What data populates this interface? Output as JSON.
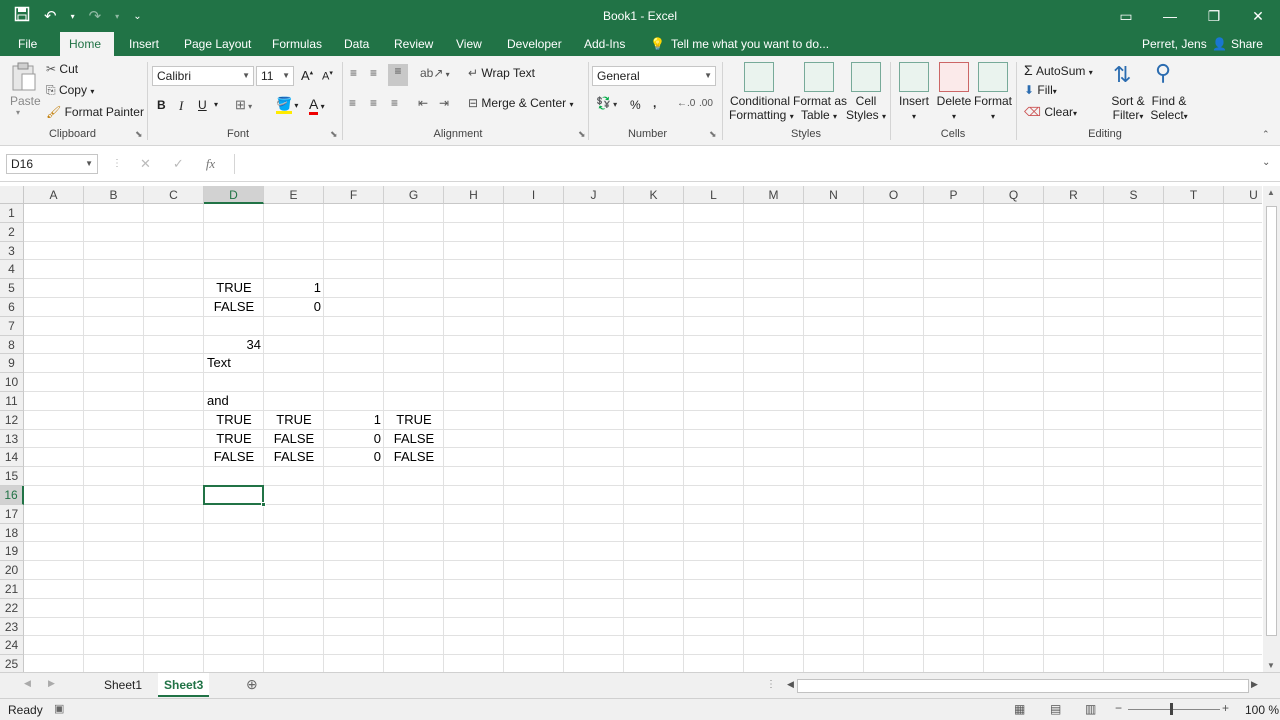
{
  "window": {
    "title": "Book1 - Excel",
    "save_icon": "save-icon",
    "undo_icon": "undo-icon",
    "redo_icon": "redo-icon"
  },
  "menu": {
    "tabs": [
      "File",
      "Home",
      "Insert",
      "Page Layout",
      "Formulas",
      "Data",
      "Review",
      "View",
      "Developer",
      "Add-Ins"
    ],
    "active_tab": "Home",
    "tell_me": "Tell me what you want to do...",
    "user": "Perret, Jens",
    "share": "Share"
  },
  "ribbon": {
    "clipboard": {
      "paste": "Paste",
      "cut": "Cut",
      "copy": "Copy",
      "format_painter": "Format Painter",
      "label": "Clipboard"
    },
    "font": {
      "name": "Calibri",
      "size": "11",
      "bold": "B",
      "italic": "I",
      "underline": "U",
      "label": "Font"
    },
    "alignment": {
      "wrap": "Wrap Text",
      "merge": "Merge & Center",
      "label": "Alignment"
    },
    "number": {
      "format": "General",
      "percent": "%",
      "comma": ",",
      "label": "Number"
    },
    "styles": {
      "cond1": "Conditional",
      "cond2": "Formatting",
      "fmt1": "Format as",
      "fmt2": "Table",
      "cell1": "Cell",
      "cell2": "Styles",
      "label": "Styles"
    },
    "cells": {
      "insert": "Insert",
      "delete": "Delete",
      "format": "Format",
      "label": "Cells"
    },
    "editing": {
      "autosum": "AutoSum",
      "fill": "Fill",
      "clear": "Clear",
      "sort1": "Sort &",
      "sort2": "Filter",
      "find1": "Find &",
      "find2": "Select",
      "label": "Editing"
    }
  },
  "formula_bar": {
    "name_box": "D16",
    "fx": "fx",
    "value": ""
  },
  "columns": [
    "A",
    "B",
    "C",
    "D",
    "E",
    "F",
    "G",
    "H",
    "I",
    "J",
    "K",
    "L",
    "M",
    "N",
    "O",
    "P",
    "Q",
    "R",
    "S",
    "T",
    "U"
  ],
  "rows": [
    "1",
    "2",
    "3",
    "4",
    "5",
    "6",
    "7",
    "8",
    "9",
    "10",
    "11",
    "12",
    "13",
    "14",
    "15",
    "16",
    "17",
    "18",
    "19",
    "20",
    "21",
    "22",
    "23",
    "24",
    "25"
  ],
  "cells": {
    "D5": "TRUE",
    "E5": "1",
    "D6": "FALSE",
    "E6": "0",
    "D8": "34",
    "D9": "Text",
    "D11": "and",
    "D12": "TRUE",
    "E12": "TRUE",
    "F12": "1",
    "G12": "TRUE",
    "D13": "TRUE",
    "E13": "FALSE",
    "F13": "0",
    "G13": "FALSE",
    "D14": "FALSE",
    "E14": "FALSE",
    "F14": "0",
    "G14": "FALSE"
  },
  "sheets": [
    "Sheet1",
    "Sheet3"
  ],
  "active_sheet": "Sheet3",
  "status": {
    "ready": "Ready",
    "zoom": "100 %"
  }
}
